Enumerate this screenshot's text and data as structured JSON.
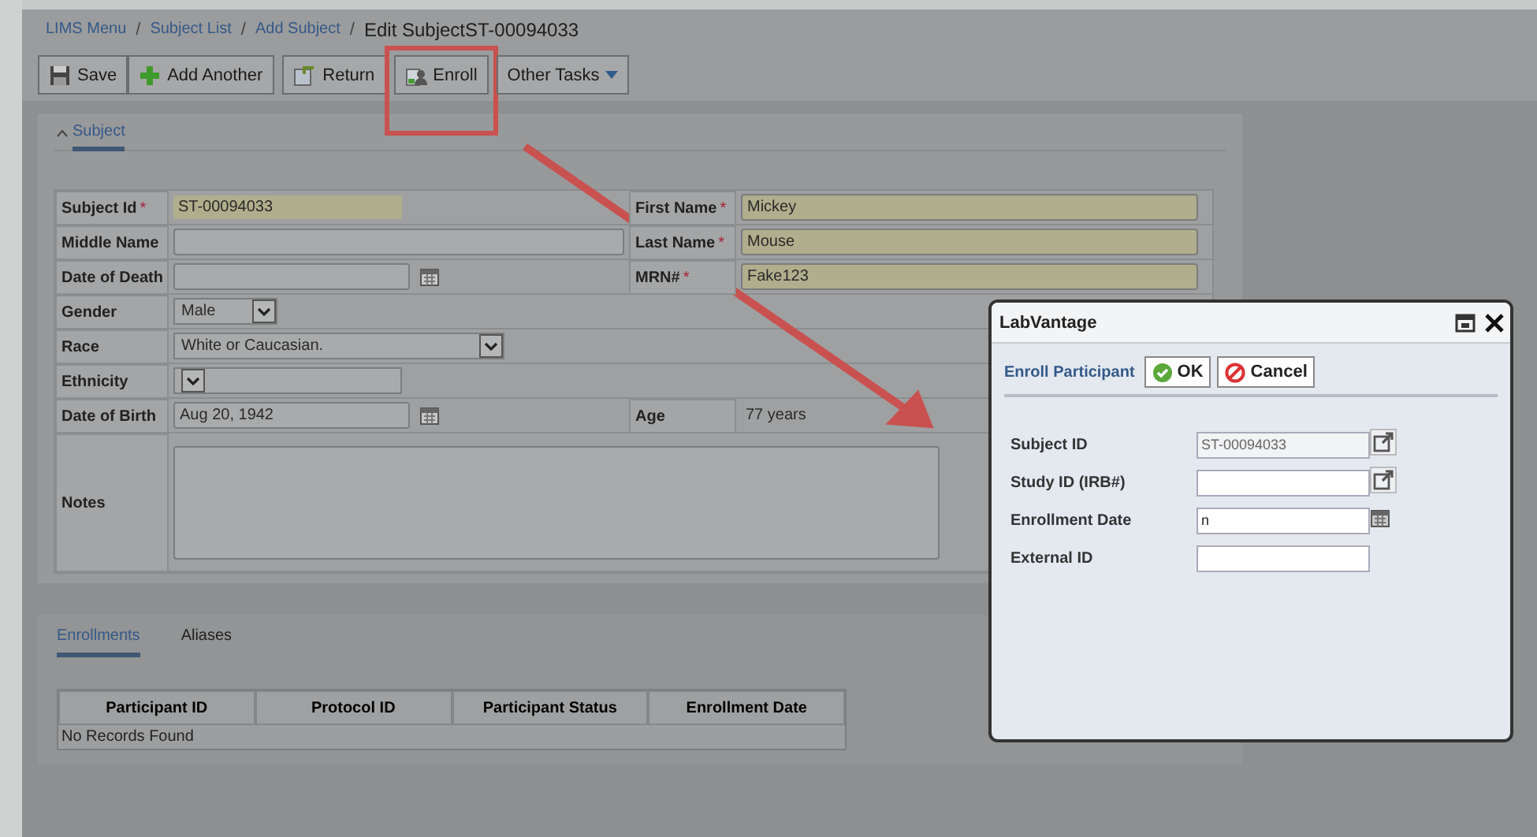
{
  "breadcrumb": [
    {
      "label": "LIMS Menu",
      "kind": "link"
    },
    {
      "separator": "/",
      "label": "Subject List",
      "kind": "link"
    },
    {
      "separator": "/",
      "label": "Add Subject",
      "kind": "link"
    },
    {
      "separator": "/",
      "label": "Edit SubjectST-00094033",
      "kind": "current"
    }
  ],
  "toolbar": [
    {
      "label": "Save",
      "highlighted": false
    },
    {
      "label": "Add Another",
      "highlighted": false
    },
    {
      "label": "Return",
      "highlighted": false
    },
    {
      "label": "Enroll",
      "highlighted": true
    },
    {
      "label": "Other Tasks",
      "highlighted": false
    }
  ],
  "subject_section": {
    "title": "Subject",
    "expanded": true,
    "rows": [
      {
        "left": {
          "label": "Subject Id",
          "required": true,
          "marker": "*",
          "kind": "static",
          "value": "ST-00094033"
        },
        "right": {
          "label": "First Name",
          "required": true,
          "marker": "*",
          "kind": "text",
          "value": "Mickey"
        }
      },
      {
        "left": {
          "label": "Middle Name",
          "required": false,
          "kind": "text"
        },
        "right": {
          "label": "Last Name",
          "required": true,
          "marker": "*",
          "kind": "text",
          "value": "Mouse"
        }
      },
      {
        "left": {
          "label": "Date of Death",
          "required": false,
          "kind": "date"
        },
        "right": {
          "label": "MRN#",
          "required": true,
          "marker": "*",
          "kind": "text",
          "value": "Fake123"
        }
      },
      {
        "left": {
          "label": "Gender",
          "required": false,
          "kind": "select",
          "value": "Male"
        }
      },
      {
        "left": {
          "label": "Race",
          "required": false,
          "kind": "select",
          "value": "White or Caucasian."
        }
      },
      {
        "left": {
          "label": "Ethnicity",
          "required": false,
          "kind": "select"
        }
      },
      {
        "left": {
          "label": "Date of Birth",
          "required": false,
          "kind": "date",
          "value": "Aug 20, 1942"
        },
        "right": {
          "label": "Age",
          "required": false,
          "kind": "static",
          "value": "77 years"
        }
      },
      {
        "left": {
          "label": "Notes",
          "required": false,
          "kind": "textarea"
        }
      }
    ]
  },
  "tabs": [
    {
      "label": "Enrollments",
      "selected": true
    },
    {
      "label": "Aliases",
      "selected": false
    }
  ],
  "table": {
    "columns": [
      "Participant ID",
      "Protocol ID",
      "Participant Status",
      "Enrollment Date"
    ],
    "empty_message": "No Records Found"
  },
  "dialog": {
    "title": "LabVantage",
    "heading": "Enroll Participant",
    "buttons": [
      {
        "label": "OK",
        "kind": "ok"
      },
      {
        "label": "Cancel",
        "kind": "cancel"
      }
    ],
    "fields": [
      {
        "label": "Subject ID",
        "kind": "lookup",
        "value": "ST-00094033",
        "readonly": true
      },
      {
        "label": "Study ID (IRB#)",
        "kind": "lookup",
        "readonly": false
      },
      {
        "label": "Enrollment Date",
        "kind": "date",
        "value": "n",
        "readonly": false
      },
      {
        "label": "External ID",
        "kind": "text",
        "readonly": false
      }
    ]
  }
}
